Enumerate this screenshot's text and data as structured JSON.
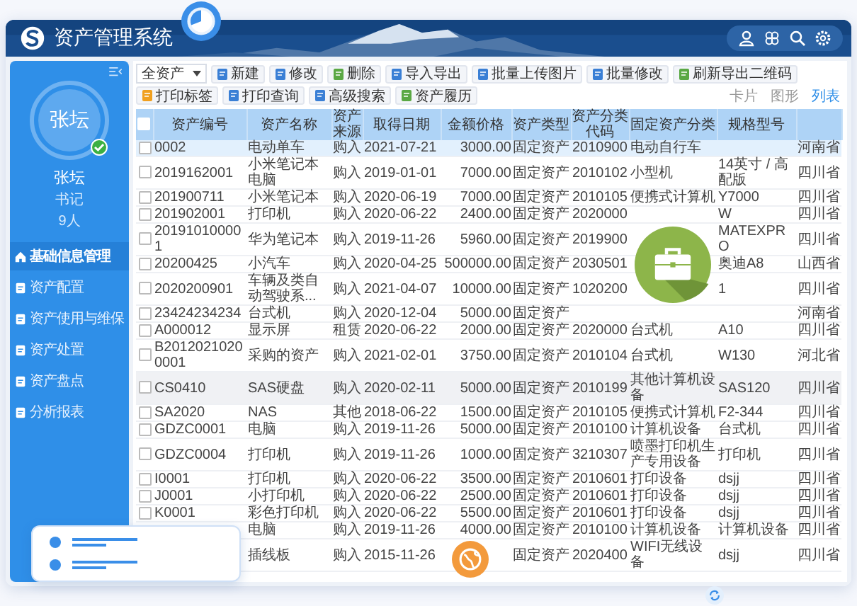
{
  "app": {
    "title": "资产管理系统"
  },
  "user": {
    "avatar_text": "张坛",
    "verified": true,
    "name": "张坛",
    "role": "书记",
    "count": "9人"
  },
  "menu": [
    {
      "label": "基础信息管理",
      "kind": "home",
      "selected": true
    },
    {
      "label": "资产配置",
      "kind": "doc",
      "selected": false
    },
    {
      "label": "资产使用与维保",
      "kind": "doc",
      "selected": false
    },
    {
      "label": "资产处置",
      "kind": "doc",
      "selected": false
    },
    {
      "label": "资产盘点",
      "kind": "doc",
      "selected": false
    },
    {
      "label": "分析报表",
      "kind": "doc",
      "selected": false
    }
  ],
  "toolbar": {
    "filter": "全资产",
    "buttons": [
      "新建",
      "修改",
      "删除",
      "导入导出",
      "批量上传图片",
      "批量修改",
      "刷新导出二维码",
      "打印标签",
      "打印查询",
      "高级搜索",
      "资产履历"
    ],
    "views": [
      {
        "label": "卡片",
        "selected": false
      },
      {
        "label": "图形",
        "selected": false
      },
      {
        "label": "列表",
        "selected": true
      }
    ]
  },
  "table": {
    "all_checked": false,
    "columns": [
      "资产编号",
      "资产名称",
      "资产来源",
      "取得日期",
      "金额价格",
      "资产类型",
      "资产分类代码",
      "固定资产分类",
      "规格型号"
    ],
    "rows": [
      {
        "selected": true,
        "hovered": false,
        "checked": false,
        "cells": [
          "0002",
          "电动单车",
          "购入",
          "2021-07-21",
          "3000.00",
          "固定资产",
          "2010900",
          "电动自行车",
          null,
          "河南省"
        ]
      },
      {
        "selected": false,
        "hovered": false,
        "checked": false,
        "cells": [
          "2019162001",
          "小米笔记本电脑",
          "购入",
          "2019-01-01",
          "7000.00",
          "固定资产",
          "2010102",
          "小型机",
          "14英寸 / 高配版",
          "四川省"
        ]
      },
      {
        "selected": false,
        "hovered": false,
        "checked": false,
        "cells": [
          "201900711",
          "小米笔记本",
          "购入",
          "2020-06-19",
          "7000.00",
          "固定资产",
          "2010105",
          "便携式计算机",
          "Y7000",
          "四川省"
        ]
      },
      {
        "selected": false,
        "hovered": false,
        "checked": false,
        "cells": [
          "201902001",
          "打印机",
          "购入",
          "2020-06-22",
          "2400.00",
          "固定资产",
          "2020000",
          null,
          "W",
          "四川省"
        ]
      },
      {
        "selected": false,
        "hovered": false,
        "checked": false,
        "cells": [
          "201910100001",
          "华为笔记本",
          "购入",
          "2019-11-26",
          "5960.00",
          "固定资产",
          "2019900",
          null,
          "MATEXPRO",
          "四川省"
        ]
      },
      {
        "selected": false,
        "hovered": false,
        "checked": false,
        "cells": [
          "20200425",
          "小汽车",
          "购入",
          "2020-04-25",
          "500000.00",
          "固定资产",
          "2030501",
          null,
          "奥迪A8",
          "山西省"
        ]
      },
      {
        "selected": false,
        "hovered": false,
        "checked": false,
        "cells": [
          "2020200901",
          "车辆及类自动驾驶系...",
          "购入",
          "2021-04-07",
          "10000.00",
          "固定资产",
          "1020200",
          null,
          "1",
          "四川省"
        ]
      },
      {
        "selected": false,
        "hovered": false,
        "checked": false,
        "cells": [
          "23424234234",
          "台式机",
          "购入",
          "2020-12-04",
          "5000.00",
          "固定资产",
          null,
          null,
          null,
          "河南省"
        ]
      },
      {
        "selected": false,
        "hovered": false,
        "checked": false,
        "cells": [
          "A000012",
          "显示屏",
          "租赁",
          "2020-06-22",
          "2000.00",
          "固定资产",
          "2020000",
          "台式机",
          "A10",
          "四川省"
        ]
      },
      {
        "selected": false,
        "hovered": false,
        "checked": false,
        "cells": [
          "B20120210200001",
          "采购的资产",
          "购入",
          "2021-02-01",
          "3750.00",
          "固定资产",
          "2010104",
          "台式机",
          "W130",
          "河北省"
        ]
      },
      {
        "selected": false,
        "hovered": true,
        "checked": false,
        "cells": [
          "CS0410",
          "SAS硬盘",
          "购入",
          "2020-02-11",
          "5000.00",
          "固定资产",
          "2010199",
          "其他计算机设备",
          "SAS120",
          "四川省"
        ]
      },
      {
        "selected": false,
        "hovered": false,
        "checked": false,
        "cells": [
          "SA2020",
          "NAS",
          "其他",
          "2018-06-22",
          "1500.00",
          "固定资产",
          "2010105",
          "便携式计算机",
          "F2-344",
          "四川省"
        ]
      },
      {
        "selected": false,
        "hovered": false,
        "checked": false,
        "cells": [
          "GDZC0001",
          "电脑",
          "购入",
          "2019-11-26",
          "5000.00",
          "固定资产",
          "2010100",
          "计算机设备",
          "台式机",
          "四川省"
        ]
      },
      {
        "selected": false,
        "hovered": false,
        "checked": false,
        "cells": [
          "GDZC0004",
          "打印机",
          "购入",
          "2019-11-26",
          "1000.00",
          "固定资产",
          "3210307",
          "喷墨打印机生产专用设备",
          "打印机",
          "四川省"
        ]
      },
      {
        "selected": false,
        "hovered": false,
        "checked": false,
        "cells": [
          "I0001",
          "打印机",
          "购入",
          "2020-06-22",
          "3500.00",
          "固定资产",
          "2010601",
          "打印设备",
          "dsjj",
          "四川省"
        ]
      },
      {
        "selected": false,
        "hovered": false,
        "checked": false,
        "cells": [
          "J0001",
          "小打印机",
          "购入",
          "2020-06-22",
          "2500.00",
          "固定资产",
          "2010601",
          "打印设备",
          "dsjj",
          "四川省"
        ]
      },
      {
        "selected": false,
        "hovered": false,
        "checked": false,
        "cells": [
          "K0001",
          "彩色打印机",
          "购入",
          "2020-06-22",
          "5500.00",
          "固定资产",
          "2010601",
          "打印设备",
          "dsjj",
          "四川省"
        ]
      },
      {
        "selected": false,
        "hovered": false,
        "cells": [
          null,
          "电脑",
          "购入",
          "2019-11-26",
          "4000.00",
          "固定资产",
          "2010100",
          "计算机设备",
          "计算机设备",
          "四川省"
        ]
      },
      {
        "selected": false,
        "hovered": false,
        "cells": [
          null,
          "插线板",
          "购入",
          "2015-11-26",
          null,
          "固定资产",
          "2020400",
          "WIFI无线设备",
          "dsjj",
          "四川省"
        ]
      }
    ]
  }
}
